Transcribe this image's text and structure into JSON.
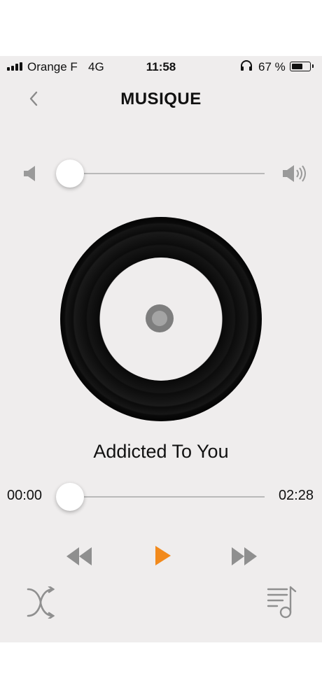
{
  "status_bar": {
    "carrier": "Orange F",
    "network": "4G",
    "time": "11:58",
    "battery_percent": "67 %",
    "battery_level": 0.67,
    "icons": [
      "signal-icon",
      "headphones-icon",
      "battery-icon"
    ]
  },
  "header": {
    "title": "MUSIQUE",
    "back_icon": "chevron-left-icon"
  },
  "volume": {
    "level": 0.0,
    "min_icon": "speaker-low-icon",
    "max_icon": "speaker-high-icon"
  },
  "player": {
    "song_title": "Addicted To You",
    "elapsed": "00:00",
    "duration": "02:28",
    "progress": 0.0,
    "artwork_icon": "vinyl-record-icon"
  },
  "controls": {
    "previous_icon": "rewind-icon",
    "play_icon": "play-icon",
    "next_icon": "fast-forward-icon",
    "shuffle_icon": "shuffle-icon",
    "playlist_icon": "playlist-icon"
  },
  "colors": {
    "accent": "#f28a1c",
    "background": "#efeded",
    "icon_gray": "#8f8f8f"
  }
}
